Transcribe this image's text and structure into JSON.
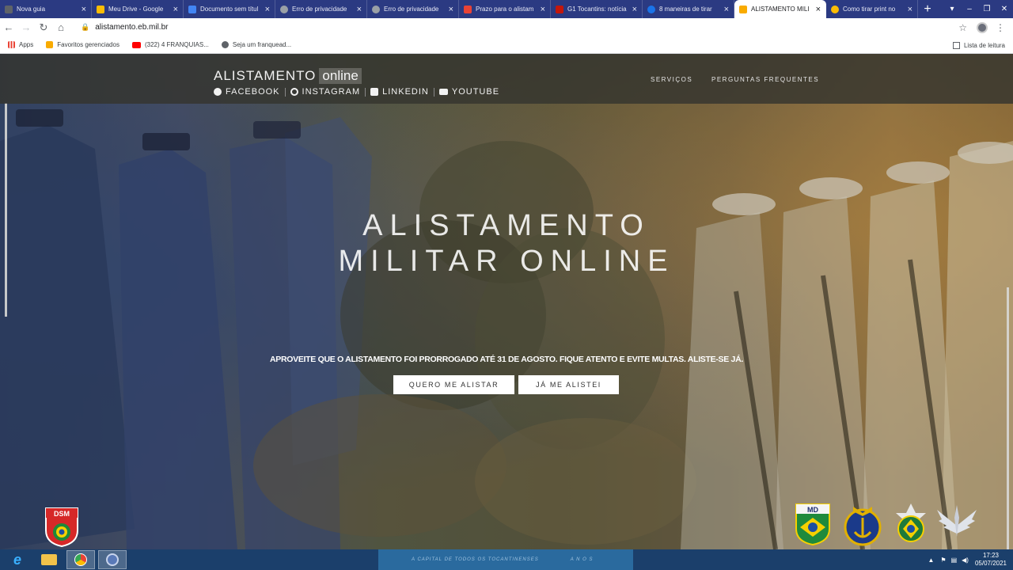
{
  "tabs": [
    {
      "label": "Nova guia",
      "color": "#5f6368",
      "active": false
    },
    {
      "label": "Meu Drive - Google",
      "color": "#fbbc04",
      "active": false
    },
    {
      "label": "Documento sem títul",
      "color": "#4285f4",
      "active": false
    },
    {
      "label": "Erro de privacidade",
      "color": "#9aa0a6",
      "active": false
    },
    {
      "label": "Erro de privacidade",
      "color": "#9aa0a6",
      "active": false
    },
    {
      "label": "Prazo para o alistam",
      "color": "#ea4335",
      "active": false
    },
    {
      "label": "G1 Tocantins: notícia",
      "color": "#c4170c",
      "active": false
    },
    {
      "label": "8 maneiras de tirar",
      "color": "#1a73e8",
      "active": false
    },
    {
      "label": "ALISTAMENTO MILI",
      "color": "#f9ab00",
      "active": true
    },
    {
      "label": "Como tirar print no",
      "color": "#fbbc04",
      "active": false
    }
  ],
  "toolbar": {
    "url": "alistamento.eb.mil.br"
  },
  "bookmarks": [
    {
      "label": "Apps",
      "color": "#ea4335"
    },
    {
      "label": "Favoritos gerenciados",
      "color": "#f9ab00"
    },
    {
      "label": "(322) 4 FRANQUIAS...",
      "color": "#ff0000"
    },
    {
      "label": "Seja um franquead...",
      "color": "#5f6368"
    }
  ],
  "reading_list": "Lista de leitura",
  "site": {
    "brand": "ALISTAMENTO",
    "brand_suffix": "online",
    "social": [
      "FACEBOOK",
      "INSTAGRAM",
      "LINKEDIN",
      "YOUTUBE"
    ],
    "nav": [
      "SERVIÇOS",
      "PERGUNTAS FREQUENTES"
    ],
    "hero_line1": "ALISTAMENTO",
    "hero_line2": "MILITAR ONLINE",
    "notice": "APROVEITE QUE O ALISTAMENTO FOI PRORROGADO ATÉ 31 DE AGOSTO. FIQUE ATENTO E EVITE MULTAS. ALISTE-SE JÁ.",
    "cta_primary": "QUERO ME ALISTAR",
    "cta_secondary": "JÁ ME ALISTEI",
    "dsm_label": "DSM",
    "md_label": "MD"
  },
  "taskbar": {
    "strip_text": "A CAPITAL DE TODOS OS TOCANTINENSES",
    "strip_text2": "A N O S",
    "time": "17:23",
    "date": "05/07/2021"
  }
}
